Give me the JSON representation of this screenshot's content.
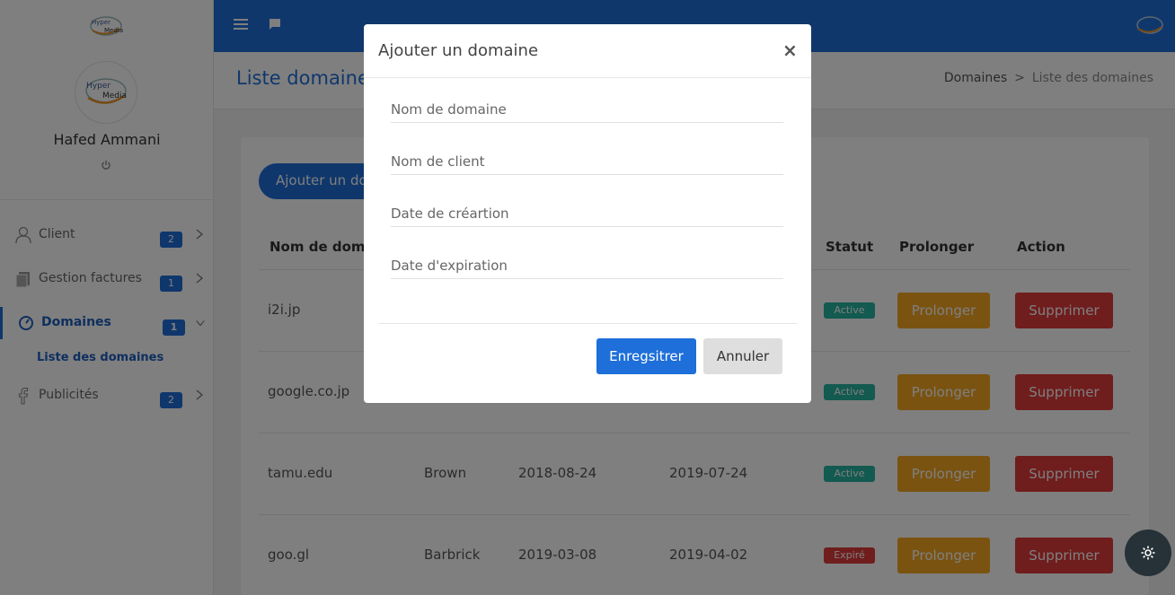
{
  "sidebar": {
    "user_name": "Hafed Ammani",
    "items": [
      {
        "label": "Client",
        "badge": "2",
        "icon": "user-icon"
      },
      {
        "label": "Gestion factures",
        "badge": "1",
        "icon": "document-icon"
      },
      {
        "label": "Domaines",
        "badge": "1",
        "icon": "dashboard-icon"
      },
      {
        "label": "Publicités",
        "badge": "2",
        "icon": "facebook-icon"
      }
    ],
    "sub_item": "Liste des domaines"
  },
  "page": {
    "title": "Liste domaines",
    "breadcrumb": [
      "Domaines",
      "Liste des domaines"
    ]
  },
  "card": {
    "add_button": "Ajouter un domaine",
    "headers": {
      "domain": "Nom de domaine",
      "status": "Statut",
      "prolong": "Prolonger",
      "action": "Action"
    },
    "rows": [
      {
        "domain": "i2i.jp",
        "client": "",
        "created": "",
        "expires": "",
        "status": "Active",
        "prolong": "Prolonger",
        "delete": "Supprimer"
      },
      {
        "domain": "google.co.jp",
        "client": "",
        "created": "",
        "expires": "",
        "status": "Active",
        "prolong": "Prolonger",
        "delete": "Supprimer"
      },
      {
        "domain": "tamu.edu",
        "client": "Brown",
        "created": "2018-08-24",
        "expires": "2019-07-24",
        "status": "Active",
        "prolong": "Prolonger",
        "delete": "Supprimer"
      },
      {
        "domain": "goo.gl",
        "client": "Barbrick",
        "created": "2019-03-08",
        "expires": "2019-04-02",
        "status": "Expiré",
        "prolong": "Prolonger",
        "delete": "Supprimer"
      }
    ]
  },
  "modal": {
    "title": "Ajouter un domaine",
    "close": "×",
    "fields": {
      "domain": "Nom de domaine",
      "client": "Nom de client",
      "created": "Date de créartion",
      "expires": "Date d'expiration"
    },
    "save": "Enregsitrer",
    "cancel": "Annuler"
  },
  "colors": {
    "primary": "#1e6fd9",
    "active": "#26b5a0",
    "expired": "#e03a3a",
    "prolong": "#f5a623",
    "delete": "#e03a3a"
  }
}
